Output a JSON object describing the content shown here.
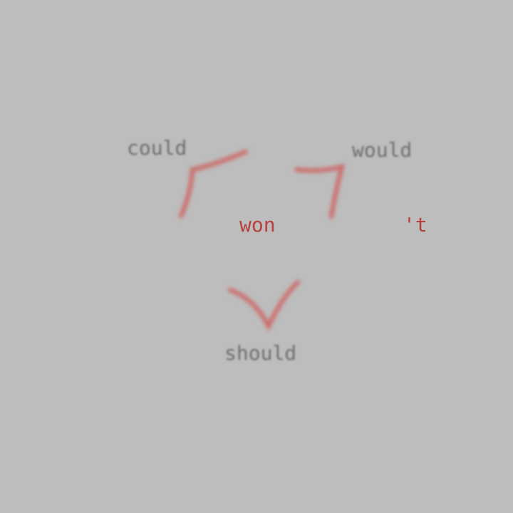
{
  "words": {
    "could": "could",
    "would": "would",
    "won": "won",
    "contraction": "'t",
    "should": "should"
  },
  "colors": {
    "background": "#bdbdbd",
    "faded_text": "#6e6e6e",
    "accent": "#b5403d",
    "stroke": "#cf5a57"
  }
}
